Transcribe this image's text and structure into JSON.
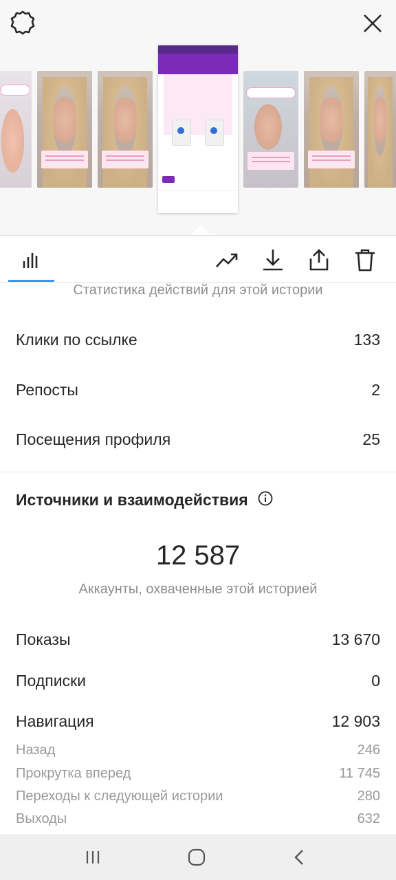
{
  "header": {
    "settings_icon": "gear-icon",
    "close_icon": "close-icon"
  },
  "toolbar": {
    "icons": [
      "bar-chart-icon",
      "trend-icon",
      "download-icon",
      "share-icon",
      "trash-icon"
    ],
    "accent": "#3897f0"
  },
  "stats": {
    "subtitle": "Статистика действий для этой истории",
    "rows": [
      {
        "label": "Клики по ссылке",
        "value": "133"
      },
      {
        "label": "Репосты",
        "value": "2"
      },
      {
        "label": "Посещения профиля",
        "value": "25"
      }
    ]
  },
  "sources": {
    "title": "Источники и взаимодействия",
    "reach_value": "12 587",
    "reach_label": "Аккаунты, охваченные этой историей",
    "rows": [
      {
        "label": "Показы",
        "value": "13 670"
      },
      {
        "label": "Подписки",
        "value": "0"
      },
      {
        "label": "Навигация",
        "value": "12 903"
      }
    ],
    "navigation": [
      {
        "label": "Назад",
        "value": "246"
      },
      {
        "label": "Прокрутка вперед",
        "value": "11 745"
      },
      {
        "label": "Переходы к следующей истории",
        "value": "280"
      },
      {
        "label": "Выходы",
        "value": "632"
      }
    ]
  },
  "system_nav": [
    "recents-icon",
    "home-icon",
    "back-icon"
  ]
}
